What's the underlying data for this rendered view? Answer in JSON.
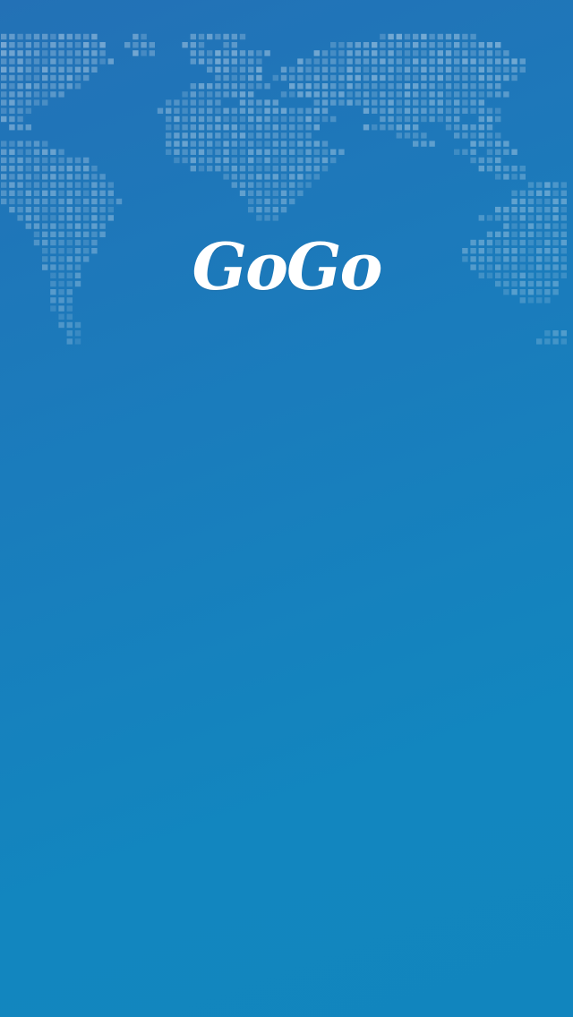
{
  "splash": {
    "app_name": "GoGo",
    "background_icon": "world-map-dots"
  },
  "colors": {
    "background_top": "#2371b6",
    "background_bottom": "#1185be",
    "map_dots": "#ffffff",
    "logo_text": "#ffffff"
  }
}
